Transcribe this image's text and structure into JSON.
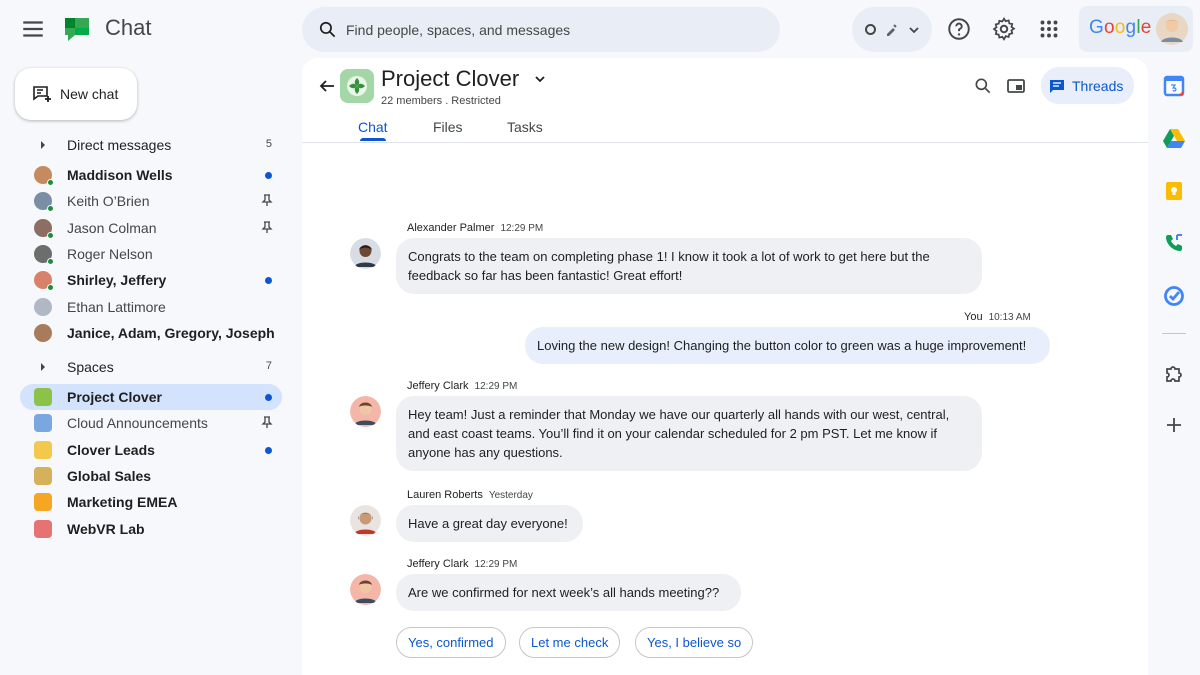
{
  "app": {
    "title": "Chat",
    "brand": "Google"
  },
  "search": {
    "placeholder": "Find people, spaces, and messages"
  },
  "sidebar": {
    "new_chat_label": "New chat",
    "direct_messages": {
      "label": "Direct messages",
      "count": "5",
      "items": [
        {
          "name": "Maddison Wells",
          "unread": true,
          "indicator": "dot",
          "online": true,
          "color": "#c58a5e"
        },
        {
          "name": "Keith O’Brien",
          "unread": false,
          "indicator": "pin",
          "online": true,
          "color": "#7a8fa6"
        },
        {
          "name": "Jason Colman",
          "unread": false,
          "indicator": "pin",
          "online": true,
          "color": "#8d6e63"
        },
        {
          "name": "Roger Nelson",
          "unread": false,
          "indicator": "none",
          "online": true,
          "color": "#6d6d6d"
        },
        {
          "name": "Shirley, Jeffery",
          "unread": true,
          "indicator": "dot",
          "online": true,
          "color": "#d9826b"
        },
        {
          "name": "Ethan Lattimore",
          "unread": false,
          "indicator": "none",
          "online": false,
          "color": "#b0b8c4"
        },
        {
          "name": "Janice, Adam, Gregory, Joseph",
          "unread": true,
          "indicator": "none",
          "online": false,
          "color": "#a87b5a"
        }
      ]
    },
    "spaces": {
      "label": "Spaces",
      "count": "7",
      "items": [
        {
          "name": "Project Clover",
          "unread": true,
          "active": true,
          "indicator": "dot",
          "color": "#8bc34a"
        },
        {
          "name": "Cloud Announcements",
          "unread": false,
          "active": false,
          "indicator": "pin",
          "color": "#7aa7e0"
        },
        {
          "name": "Clover Leads",
          "unread": true,
          "active": false,
          "indicator": "dot",
          "color": "#f2c94c"
        },
        {
          "name": "Global Sales",
          "unread": true,
          "active": false,
          "indicator": "none",
          "color": "#d4b15a"
        },
        {
          "name": "Marketing EMEA",
          "unread": true,
          "active": false,
          "indicator": "none",
          "color": "#f5a623"
        },
        {
          "name": "WebVR Lab",
          "unread": true,
          "active": false,
          "indicator": "none",
          "color": "#e57373"
        }
      ]
    }
  },
  "space": {
    "title": "Project Clover",
    "subtitle": "22 members . Restricted",
    "threads_label": "Threads",
    "tabs": [
      {
        "label": "Chat",
        "active": true
      },
      {
        "label": "Files",
        "active": false
      },
      {
        "label": "Tasks",
        "active": false
      }
    ]
  },
  "messages": [
    {
      "sender": "Alexander Palmer",
      "time": "12:29 PM",
      "text": "Congrats to the team on completing phase 1! I know it took a lot of work to get here but the feedback so far has been fantastic! Great effort!",
      "mine": false
    },
    {
      "sender": "You",
      "time": "10:13 AM",
      "text": "Loving the new design! Changing the button color to green was a huge improvement!",
      "mine": true
    },
    {
      "sender": "Jeffery Clark",
      "time": "12:29 PM",
      "text": "Hey team! Just a reminder that Monday we have our quarterly all hands with our west, central, and east coast teams. You’ll find it on your calendar scheduled for 2 pm PST. Let me know if anyone has any questions.",
      "mine": false
    },
    {
      "sender": "Lauren Roberts",
      "time": "Yesterday",
      "text": "Have a great day everyone!",
      "mine": false
    },
    {
      "sender": "Jeffery Clark",
      "time": "12:29 PM",
      "text": "Are we confirmed for next week’s all hands meeting??",
      "mine": false
    }
  ],
  "smart_replies": [
    "Yes, confirmed",
    "Let me check",
    "Yes, I believe so"
  ],
  "colors": {
    "accent": "#0b57d0",
    "active_bg": "#d3e3fd",
    "online": "#1e8e3e",
    "background": "#f6f8fc"
  }
}
